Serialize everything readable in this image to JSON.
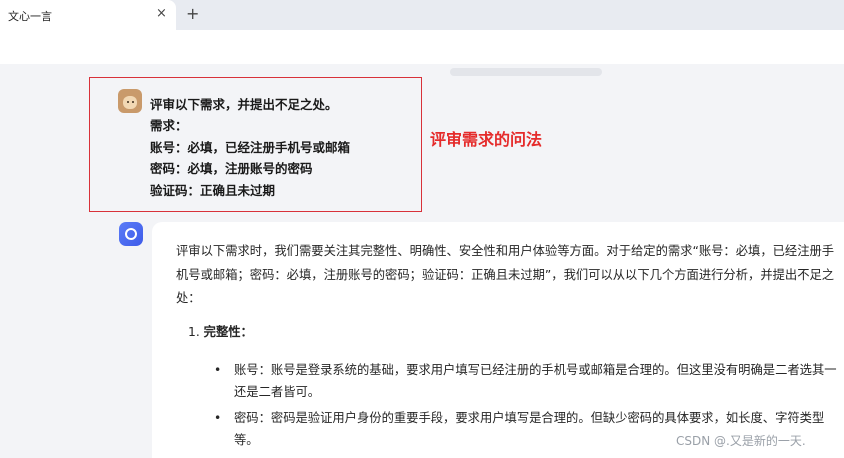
{
  "browser": {
    "tab_title": "文心一言",
    "tab_close": "×",
    "new_tab": "+"
  },
  "user_message": {
    "lines": [
      "评审以下需求，并提出不足之处。",
      "需求：",
      "账号：必填，已经注册手机号或邮箱",
      "密码：必填，注册账号的密码",
      "验证码：正确且未过期"
    ]
  },
  "annotation": {
    "text": "评审需求的问法",
    "color": "#e52b2b"
  },
  "bot_reply": {
    "intro": "评审以下需求时，我们需要关注其完整性、明确性、安全性和用户体验等方面。对于给定的需求“账号：必填，已经注册手机号或邮箱；密码：必填，注册账号的密码；验证码：正确且未过期”，我们可以从以下几个方面进行分析，并提出不足之处：",
    "section_number": "1.",
    "section_title": "完整性：",
    "bullets": [
      "账号：账号是登录系统的基础，要求用户填写已经注册的手机号或邮箱是合理的。但这里没有明确是二者选其一还是二者皆可。",
      "密码：密码是验证用户身份的重要手段，要求用户填写是合理的。但缺少密码的具体要求，如长度、字符类型等。"
    ],
    "bullet_symbol": "•"
  },
  "watermark": "CSDN @.又是新的一天.",
  "colors": {
    "highlight_border": "#d8313a",
    "bot_avatar": "#3d5be9",
    "page_bg": "#f3f4f7"
  }
}
